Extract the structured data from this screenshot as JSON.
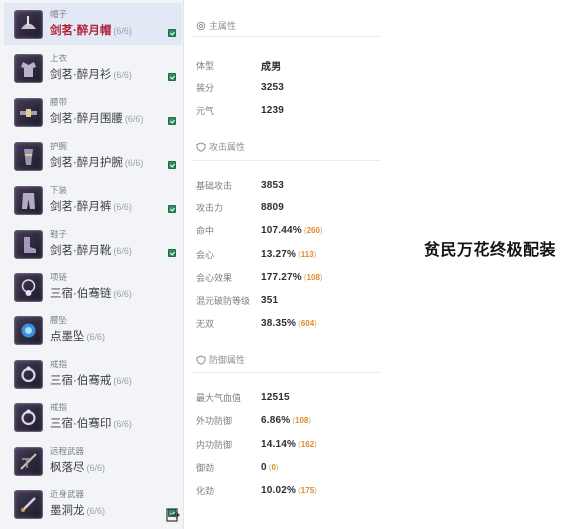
{
  "equipment": [
    {
      "slot": "帽子",
      "name": "剑茗·醉月帽",
      "count": "(6/6)",
      "selected": true,
      "marked": true,
      "icon": "hat-icon"
    },
    {
      "slot": "上衣",
      "name": "剑茗·醉月衫",
      "count": "(6/6)",
      "selected": false,
      "marked": true,
      "icon": "robe-icon"
    },
    {
      "slot": "腰带",
      "name": "剑茗·醉月围腰",
      "count": "(6/6)",
      "selected": false,
      "marked": true,
      "icon": "belt-icon"
    },
    {
      "slot": "护腕",
      "name": "剑茗·醉月护腕",
      "count": "(6/6)",
      "selected": false,
      "marked": true,
      "icon": "bracer-icon"
    },
    {
      "slot": "下装",
      "name": "剑茗·醉月裤",
      "count": "(6/6)",
      "selected": false,
      "marked": true,
      "icon": "pants-icon"
    },
    {
      "slot": "鞋子",
      "name": "剑茗·醉月靴",
      "count": "(6/6)",
      "selected": false,
      "marked": true,
      "icon": "boots-icon"
    },
    {
      "slot": "项链",
      "name": "三宿·伯骞链",
      "count": "(6/6)",
      "selected": false,
      "marked": false,
      "icon": "necklace-icon"
    },
    {
      "slot": "腰坠",
      "name": "点墨坠",
      "count": "(6/6)",
      "selected": false,
      "marked": false,
      "icon": "pendant-icon"
    },
    {
      "slot": "戒指",
      "name": "三宿·伯骞戒",
      "count": "(6/6)",
      "selected": false,
      "marked": false,
      "icon": "ring-icon"
    },
    {
      "slot": "戒指",
      "name": "三宿·伯骞印",
      "count": "(6/6)",
      "selected": false,
      "marked": false,
      "icon": "ring-icon"
    },
    {
      "slot": "远程武器",
      "name": "枫落尽",
      "count": "(6/6)",
      "selected": false,
      "marked": false,
      "icon": "ranged-weapon-icon"
    },
    {
      "slot": "近身武器",
      "name": "墨洞龙",
      "count": "(6/6)",
      "selected": false,
      "marked": true,
      "icon": "melee-weapon-icon"
    }
  ],
  "sections": {
    "main": {
      "title": "主属性",
      "icon": "at-icon",
      "rows": [
        {
          "label": "体型",
          "value": "成男"
        },
        {
          "label": "装分",
          "value": "3253"
        },
        {
          "label": "元气",
          "value": "1239"
        }
      ]
    },
    "attack": {
      "title": "攻击属性",
      "icon": "shield-icon",
      "rows": [
        {
          "label": "基础攻击",
          "value": "3853"
        },
        {
          "label": "攻击力",
          "value": "8809"
        },
        {
          "label": "命中",
          "value": "107.44%",
          "extra": "260"
        },
        {
          "label": "会心",
          "value": "13.27%",
          "extra": "113"
        },
        {
          "label": "会心效果",
          "value": "177.27%",
          "extra": "108"
        },
        {
          "label": "混元破防等级",
          "value": "351"
        },
        {
          "label": "无双",
          "value": "38.35%",
          "extra": "604"
        }
      ]
    },
    "defense": {
      "title": "防御属性",
      "icon": "shield-icon",
      "rows": [
        {
          "label": "最大气血值",
          "value": "12515"
        },
        {
          "label": "外功防御",
          "value": "6.86%",
          "extra": "108"
        },
        {
          "label": "内功防御",
          "value": "14.14%",
          "extra": "162"
        },
        {
          "label": "御劲",
          "value": "0",
          "extra": "0"
        },
        {
          "label": "化劲",
          "value": "10.02%",
          "extra": "175"
        }
      ]
    }
  },
  "banner": {
    "title": "贫民万花终极配装"
  },
  "colors": {
    "selected_name": "#b0253b",
    "extra_value": "#e08a2a",
    "mark_green": "#2f8f62",
    "list_bg": "#f3f4f7"
  }
}
